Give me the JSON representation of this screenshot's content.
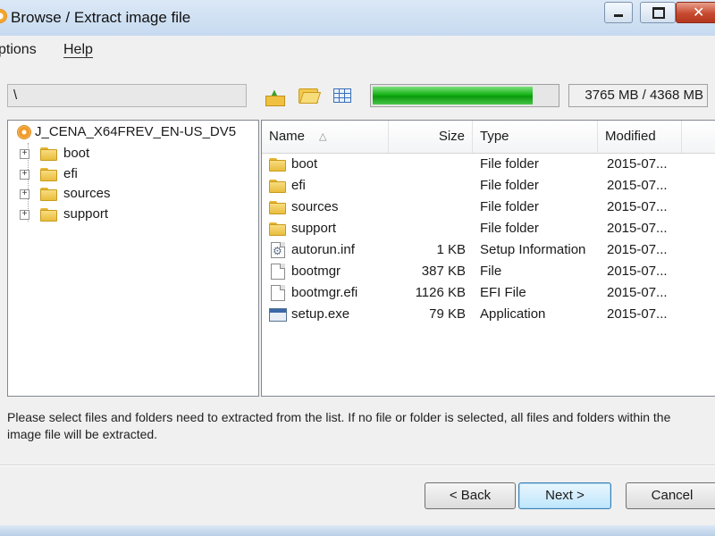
{
  "window": {
    "title": "Browse / Extract image file",
    "close_glyph": "✕"
  },
  "menu": [
    {
      "label": "Options",
      "visible": "ptions"
    },
    {
      "label": "Help"
    }
  ],
  "toolbar": {
    "path": "\\",
    "progress_fraction": 0.86,
    "size_readout": "3765 MB / 4368 MB"
  },
  "tree": {
    "root": "J_CENA_X64FREV_EN-US_DV5",
    "items": [
      "boot",
      "efi",
      "sources",
      "support"
    ]
  },
  "list": {
    "columns": {
      "name": "Name",
      "size": "Size",
      "type": "Type",
      "modified": "Modified"
    },
    "rows": [
      {
        "name": "boot",
        "size": "",
        "type": "File folder",
        "modified": "2015-07...",
        "icon": "folder-icon"
      },
      {
        "name": "efi",
        "size": "",
        "type": "File folder",
        "modified": "2015-07...",
        "icon": "folder-icon"
      },
      {
        "name": "sources",
        "size": "",
        "type": "File folder",
        "modified": "2015-07...",
        "icon": "folder-icon"
      },
      {
        "name": "support",
        "size": "",
        "type": "File folder",
        "modified": "2015-07...",
        "icon": "folder-icon"
      },
      {
        "name": "autorun.inf",
        "size": "1 KB",
        "type": "Setup Information",
        "modified": "2015-07...",
        "icon": "settings-file-icon"
      },
      {
        "name": "bootmgr",
        "size": "387 KB",
        "type": "File",
        "modified": "2015-07...",
        "icon": "file-icon"
      },
      {
        "name": "bootmgr.efi",
        "size": "1126 KB",
        "type": "EFI File",
        "modified": "2015-07...",
        "icon": "file-icon"
      },
      {
        "name": "setup.exe",
        "size": "79 KB",
        "type": "Application",
        "modified": "2015-07...",
        "icon": "application-icon"
      }
    ]
  },
  "hint": "Please select files and folders need to extracted from the list. If no file or folder is selected, all files and folders within the image file will be extracted.",
  "buttons": {
    "back": "< Back",
    "next": "Next >",
    "cancel": "Cancel"
  }
}
